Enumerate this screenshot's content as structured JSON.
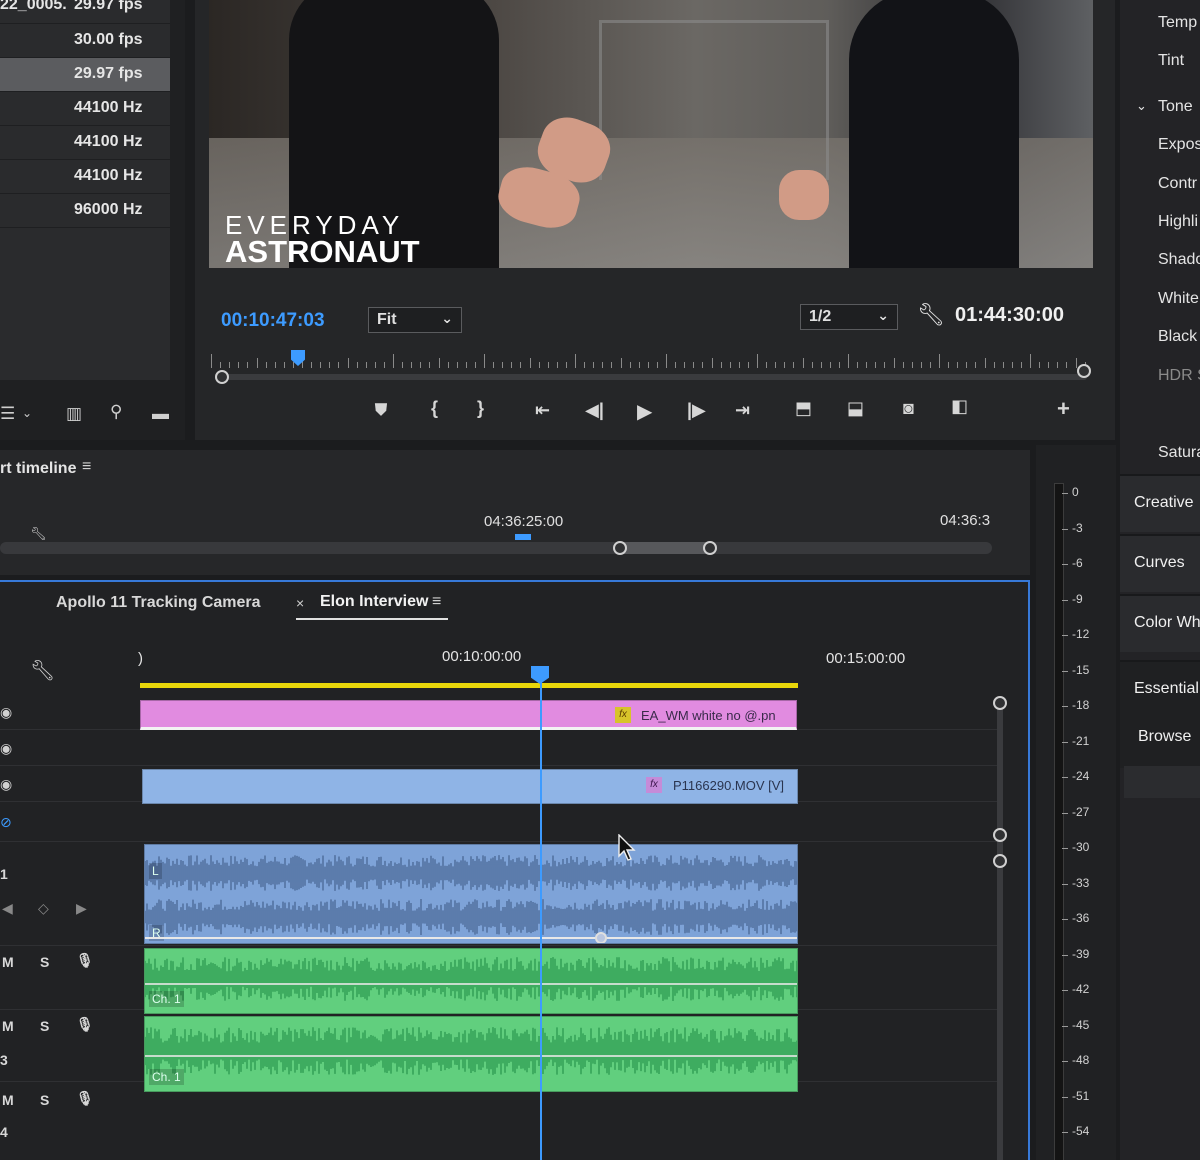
{
  "project_panel": {
    "rows": [
      {
        "name": "22_0005.",
        "value": "29.97 fps",
        "selected": false
      },
      {
        "name": "",
        "value": "30.00 fps",
        "selected": false
      },
      {
        "name": "",
        "value": "29.97 fps",
        "selected": true
      },
      {
        "name": "",
        "value": "44100 Hz",
        "selected": false
      },
      {
        "name": "",
        "value": "44100 Hz",
        "selected": false
      },
      {
        "name": "",
        "value": "44100 Hz",
        "selected": false
      },
      {
        "name": "",
        "value": "96000 Hz",
        "selected": false
      }
    ],
    "toolbar_icons": [
      "list-icon",
      "chevron-down-icon",
      "storyboard-icon",
      "search-icon",
      "folder-icon"
    ]
  },
  "program_monitor": {
    "watermark": {
      "line1": "EVERYDAY",
      "line2": "ASTRONAUT"
    },
    "playhead_time": "00:10:47:03",
    "zoom": "Fit",
    "resolution": "1/2",
    "duration": "01:44:30:00",
    "transport_icons": [
      "add-marker-icon",
      "mark-in-icon",
      "mark-out-icon",
      "go-to-in-icon",
      "step-back-icon",
      "play-icon",
      "step-forward-icon",
      "go-to-out-icon",
      "lift-icon",
      "extract-icon",
      "export-frame-icon",
      "comparison-view-icon",
      "button-editor-icon"
    ]
  },
  "lumetri": {
    "items": [
      "Temp",
      "Tint",
      "Tone",
      "Expos",
      "Contr",
      "Highli",
      "Shado",
      "White",
      "Black",
      "HDR S",
      "Satura"
    ],
    "sections": [
      "Creative",
      "Curves",
      "Color Wh"
    ],
    "bottom_tabs": [
      "Essential",
      "Browse"
    ]
  },
  "source_strip": {
    "title": "rt timeline",
    "time1": "04:36:25:00",
    "time2": "04:36:3"
  },
  "meter": {
    "labels": [
      "0",
      "-3",
      "-6",
      "-9",
      "-12",
      "-15",
      "-18",
      "-21",
      "-24",
      "-27",
      "-30",
      "-33",
      "-36",
      "-39",
      "-42",
      "-45",
      "-48",
      "-51",
      "-54"
    ]
  },
  "timeline": {
    "tabs": {
      "inactive": "Apollo 11 Tracking Camera",
      "active": "Elon Interview"
    },
    "timecodes": {
      "start": ")",
      "mid": "00:10:00:00",
      "end": "00:15:00:00"
    },
    "clips": {
      "v3": {
        "name": "EA_WM white no @.pn",
        "fx": "fx",
        "color": "#e18be0"
      },
      "v1": {
        "name": "P1166290.MOV [V]",
        "fx": "fx",
        "color": "#8fb4e6"
      },
      "a1_label_l": "L",
      "a1_label_r": "R",
      "a2_label": "Ch. 1",
      "a3_label": "Ch. 1"
    },
    "track_controls": {
      "mute": "M",
      "solo": "S"
    },
    "track_numbers": {
      "a1": "1",
      "a3": "3",
      "a4": "4"
    }
  }
}
